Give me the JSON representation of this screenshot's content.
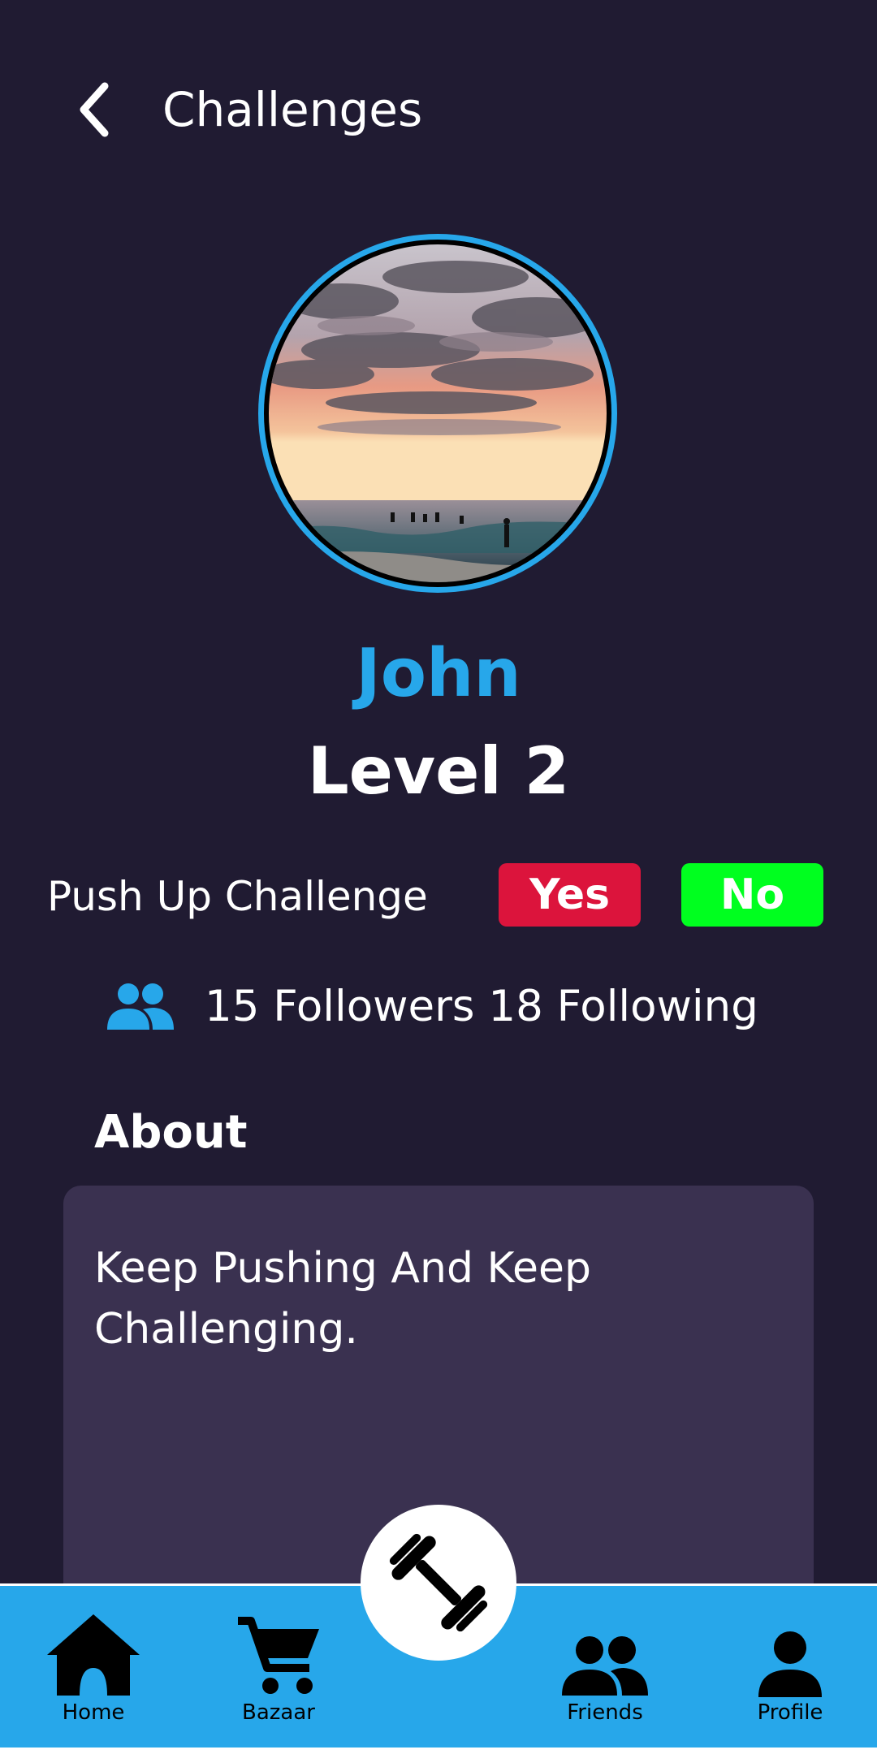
{
  "header": {
    "title": "Challenges"
  },
  "profile": {
    "name": "John",
    "level": "Level 2"
  },
  "challenge": {
    "label": "Push Up Challenge",
    "yes_label": "Yes",
    "no_label": "No"
  },
  "social": {
    "text": "15 Followers 18 Following"
  },
  "about": {
    "heading": "About",
    "text": "Keep Pushing And Keep Challenging."
  },
  "nav": {
    "items": [
      {
        "label": "Home",
        "icon": "home-icon"
      },
      {
        "label": "Bazaar",
        "icon": "cart-icon"
      },
      {
        "label": "Friends",
        "icon": "friends-icon"
      },
      {
        "label": "Profile",
        "icon": "profile-icon"
      }
    ],
    "center_icon": "dumbbell-icon"
  },
  "colors": {
    "background": "#201b32",
    "accent": "#27a7ea",
    "card": "#3a3150",
    "yes": "#dc143c",
    "no": "#00ff1f"
  }
}
